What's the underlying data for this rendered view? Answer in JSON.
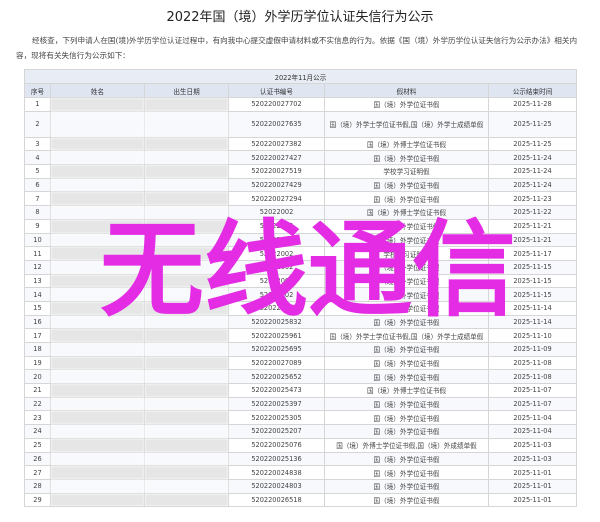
{
  "page": {
    "title": "2022年国（境）外学历学位认证失信行为公示",
    "intro": "经核查，下列申请人在国(境)外学历学位认证过程中，有向我中心提交虚假申请材料或不实信息的行为。依据《国（境）外学历学位认证失信行为公示办法》相关内容，现将有关失信行为公示如下："
  },
  "table": {
    "caption": "2022年11月公示",
    "headers": [
      "序号",
      "姓名",
      "出生日期",
      "认证书编号",
      "假材料",
      "公示结束时间"
    ],
    "rows": [
      {
        "no": "1",
        "id": "520220027702",
        "item": "国（境）外学位证书假",
        "date": "2025-11-28"
      },
      {
        "no": "2",
        "id": "520220027635",
        "item": "国（境）外学士学位证书假,国（境）外学士成绩单假",
        "date": "2025-11-25",
        "tall": true
      },
      {
        "no": "3",
        "id": "520220027382",
        "item": "国（境）外博士学位证书假",
        "date": "2025-11-25"
      },
      {
        "no": "4",
        "id": "520220027427",
        "item": "国（境）外学位证书假",
        "date": "2025-11-24"
      },
      {
        "no": "5",
        "id": "520220027519",
        "item": "学校学习证明假",
        "date": "2025-11-24"
      },
      {
        "no": "6",
        "id": "520220027429",
        "item": "国（境）外学位证书假",
        "date": "2025-11-24"
      },
      {
        "no": "7",
        "id": "520220027294",
        "item": "国（境）外学位证书假",
        "date": "2025-11-23"
      },
      {
        "no": "8",
        "id": "52022002",
        "item": "国（境）外博士学位证书假",
        "date": "2025-11-22"
      },
      {
        "no": "9",
        "id": "52022002",
        "item": "国（境）外学位证书假",
        "date": "2025-11-21"
      },
      {
        "no": "10",
        "id": "52022002",
        "item": "国（境）外学位证书假",
        "date": "2025-11-21"
      },
      {
        "no": "11",
        "id": "52022002",
        "item": "学校学习证明假",
        "date": "2025-11-17"
      },
      {
        "no": "12",
        "id": "52022002",
        "item": "国（境）外学位证书假",
        "date": "2025-11-15"
      },
      {
        "no": "13",
        "id": "52022002",
        "item": "国（境）外学位证书假",
        "date": "2025-11-15"
      },
      {
        "no": "14",
        "id": "52022002",
        "item": "国（境）外学位证书假",
        "date": "2025-11-15"
      },
      {
        "no": "15",
        "id": "52022002",
        "item": "国（境）外学位证书假",
        "date": "2025-11-14"
      },
      {
        "no": "16",
        "id": "520220025832",
        "item": "国（境）外学位证书假",
        "date": "2025-11-14"
      },
      {
        "no": "17",
        "id": "520220025961",
        "item": "国（境）外学士学位证书假,国（境）外学士成绩单假",
        "date": "2025-11-10"
      },
      {
        "no": "18",
        "id": "520220025695",
        "item": "国（境）外学位证书假",
        "date": "2025-11-09"
      },
      {
        "no": "19",
        "id": "520220027089",
        "item": "国（境）外学位证书假",
        "date": "2025-11-08"
      },
      {
        "no": "20",
        "id": "520220025652",
        "item": "国（境）外学位证书假",
        "date": "2025-11-08"
      },
      {
        "no": "21",
        "id": "520220025473",
        "item": "国（境）外博士学位证书假",
        "date": "2025-11-07"
      },
      {
        "no": "22",
        "id": "520220025397",
        "item": "国（境）外学位证书假",
        "date": "2025-11-07"
      },
      {
        "no": "23",
        "id": "520220025305",
        "item": "国（境）外学位证书假",
        "date": "2025-11-04"
      },
      {
        "no": "24",
        "id": "520220025207",
        "item": "国（境）外学位证书假",
        "date": "2025-11-04"
      },
      {
        "no": "25",
        "id": "520220025076",
        "item": "国（境）外博士学位证书假,国（境）外成绩单假",
        "date": "2025-11-03"
      },
      {
        "no": "26",
        "id": "520220025136",
        "item": "国（境）外学位证书假",
        "date": "2025-11-03"
      },
      {
        "no": "27",
        "id": "520220024838",
        "item": "国（境）外学位证书假",
        "date": "2025-11-01"
      },
      {
        "no": "28",
        "id": "520220024803",
        "item": "国（境）外学位证书假",
        "date": "2025-11-01"
      },
      {
        "no": "29",
        "id": "520220026518",
        "item": "国（境）外学位证书假",
        "date": "2025-11-01"
      }
    ]
  },
  "watermark": {
    "text": "无线通信",
    "color": "#e42ce4"
  }
}
